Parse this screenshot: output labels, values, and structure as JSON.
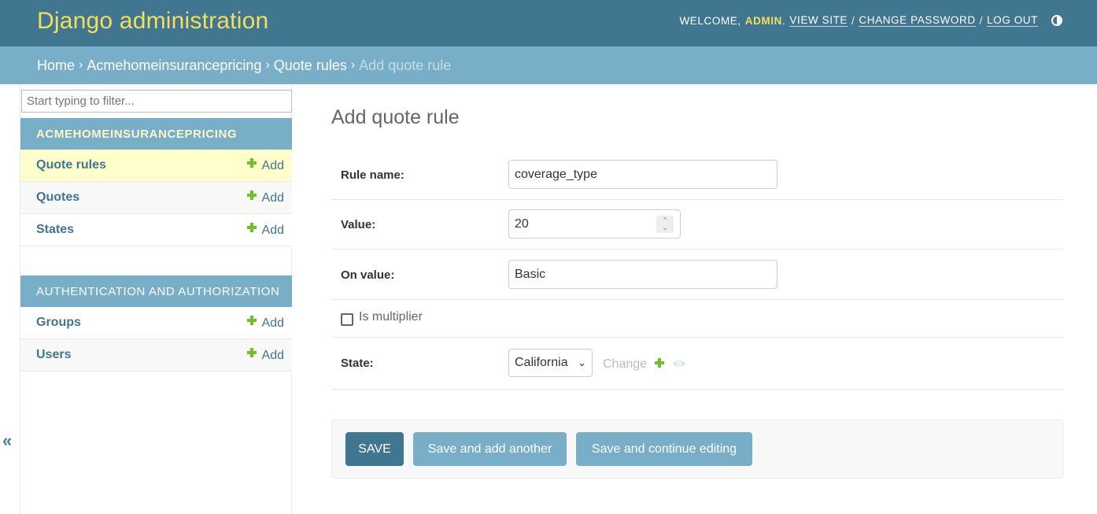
{
  "header": {
    "branding": "Django administration",
    "welcome": "WELCOME,",
    "username": "ADMIN",
    "view_site": "VIEW SITE",
    "change_password": "CHANGE PASSWORD",
    "log_out": "LOG OUT",
    "separator": "/",
    "theme_icon": "contrast-icon"
  },
  "breadcrumbs": {
    "items": [
      "Home",
      "Acmehomeinsurancepricing",
      "Quote rules"
    ],
    "current": "Add quote rule",
    "separator": "›"
  },
  "sidebar": {
    "filter_placeholder": "Start typing to filter...",
    "modules": [
      {
        "caption": "ACMEHOMEINSURANCEPRICING",
        "models": [
          {
            "name": "Quote rules",
            "add": "Add",
            "current": true
          },
          {
            "name": "Quotes",
            "add": "Add"
          },
          {
            "name": "States",
            "add": "Add"
          }
        ]
      },
      {
        "caption": "AUTHENTICATION AND AUTHORIZATION",
        "models": [
          {
            "name": "Groups",
            "add": "Add"
          },
          {
            "name": "Users",
            "add": "Add"
          }
        ]
      }
    ],
    "collapse_toggle": "«"
  },
  "content": {
    "title": "Add quote rule",
    "fields": {
      "rule_name": {
        "label": "Rule name:",
        "value": "coverage_type"
      },
      "value": {
        "label": "Value:",
        "value": "20"
      },
      "on_value": {
        "label": "On value:",
        "value": "Basic"
      },
      "is_multiplier": {
        "label": "Is multiplier",
        "checked": false
      },
      "state": {
        "label": "State:",
        "selected": "California",
        "change": "Change"
      }
    }
  },
  "submit": {
    "save": "SAVE",
    "save_add_another": "Save and add another",
    "save_continue": "Save and continue editing"
  },
  "colors": {
    "header_bg": "#417690",
    "breadcrumb_bg": "#79aec8",
    "branding": "#f5dd5d",
    "add_green": "#70bf2b",
    "current_row": "#ffffcc"
  }
}
